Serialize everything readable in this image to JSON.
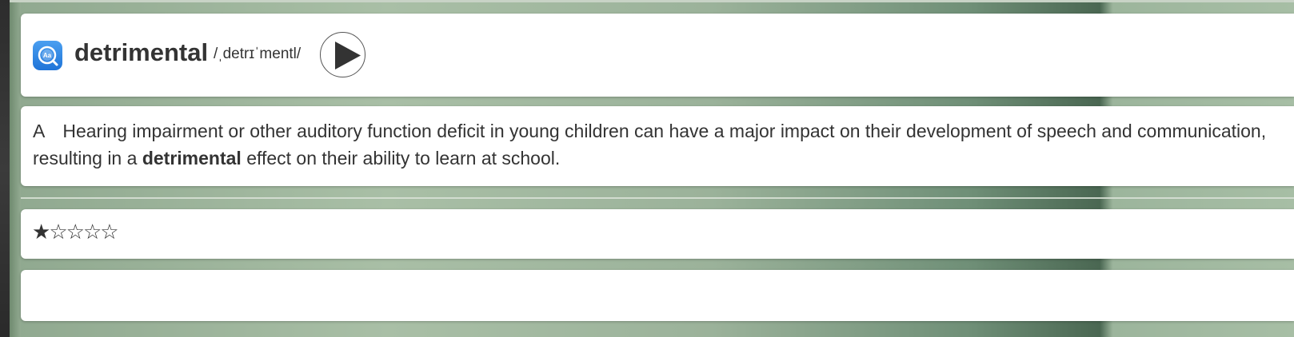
{
  "word_card": {
    "icon": "dictionary-app-icon",
    "word": "detrimental",
    "phonetic": "/ˌdetrɪˈmentl/",
    "play_icon": "play-icon"
  },
  "sentence_card": {
    "label": "A",
    "text_before": "Hearing impairment or other auditory function deficit in young children can have a major impact on their development of speech and communication, resulting in a",
    "highlight": "detrimental",
    "text_after": "effect on their ability to learn at school."
  },
  "rating_card": {
    "rating": 1,
    "max": 5,
    "stars": [
      "★",
      "☆",
      "☆",
      "☆",
      "☆"
    ]
  },
  "empty_card": {}
}
